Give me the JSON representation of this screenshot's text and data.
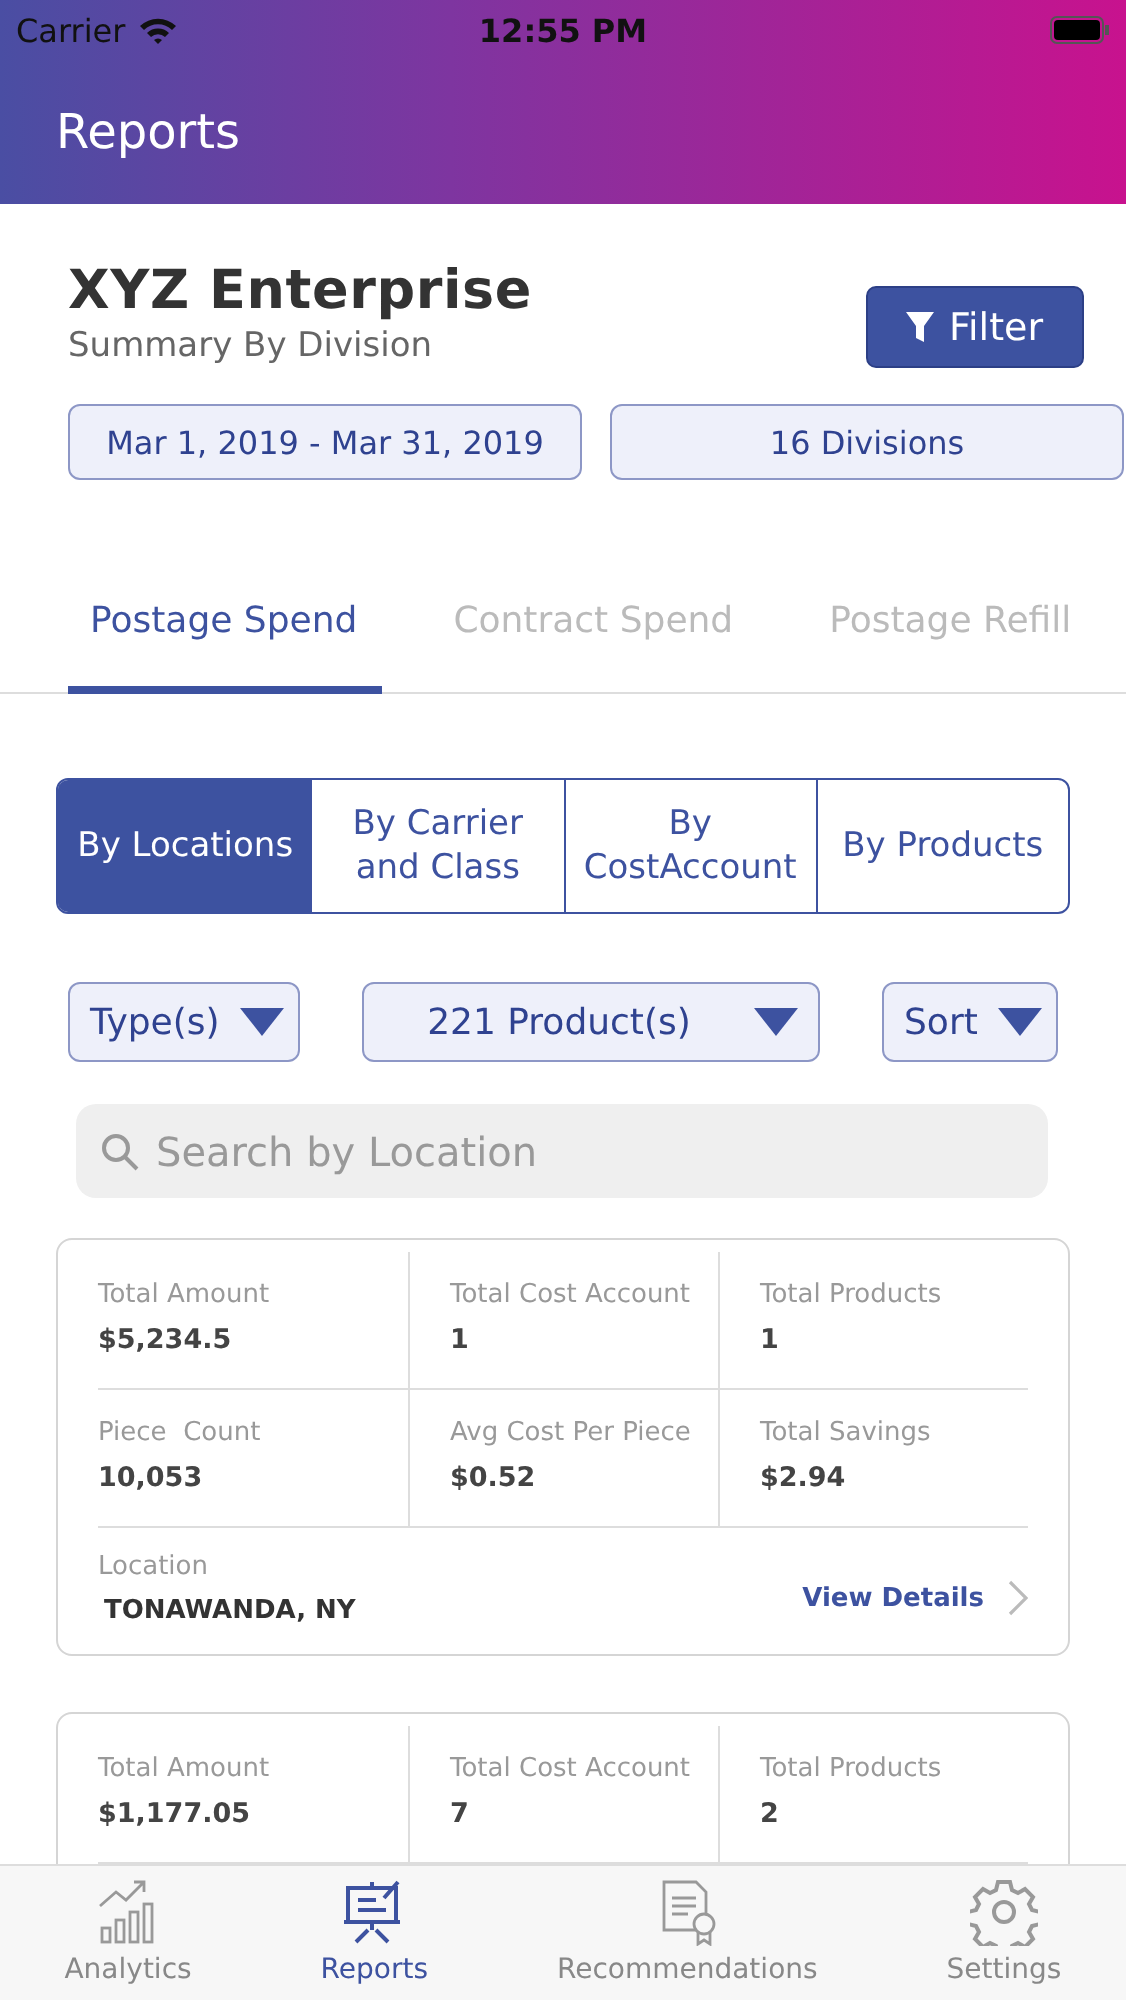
{
  "status_bar": {
    "carrier": "Carrier",
    "time": "12:55 PM"
  },
  "header": {
    "title": "Reports"
  },
  "summary": {
    "company": "XYZ Enterprise",
    "subtitle": "Summary By Division",
    "filter_button": "Filter",
    "chips": [
      "Mar 1, 2019 - Mar 31, 2019",
      "16 Divisions"
    ]
  },
  "tabs": [
    {
      "label": "Postage Spend",
      "selected": true
    },
    {
      "label": "Contract Spend",
      "selected": false
    },
    {
      "label": "Postage Refill",
      "selected": false
    }
  ],
  "segments": [
    {
      "label": "By Locations",
      "selected": true
    },
    {
      "label": "By Carrier and Class",
      "selected": false
    },
    {
      "label": "By CostAccount",
      "selected": false
    },
    {
      "label": "By Products",
      "selected": false
    }
  ],
  "dropdowns": [
    "Type(s)",
    "221 Product(s)",
    "Sort"
  ],
  "search": {
    "placeholder": "Search by Location"
  },
  "cards": [
    {
      "metrics": [
        {
          "label": "Total Amount",
          "value": "$5,234.5"
        },
        {
          "label": "Total Cost Account",
          "value": "1"
        },
        {
          "label": "Total Products",
          "value": "1"
        },
        {
          "label": "Piece  Count",
          "value": "10,053"
        },
        {
          "label": "Avg Cost Per Piece",
          "value": "$0.52"
        },
        {
          "label": "Total Savings",
          "value": "$2.94"
        }
      ],
      "location_label": "Location",
      "location": "TONAWANDA, NY",
      "link": "View Details"
    },
    {
      "metrics": [
        {
          "label": "Total Amount",
          "value": "$1,177.05"
        },
        {
          "label": "Total Cost Account",
          "value": "7"
        },
        {
          "label": "Total Products",
          "value": "2"
        }
      ]
    }
  ],
  "tab_bar": [
    {
      "label": "Analytics",
      "kind": "chart",
      "selected": false
    },
    {
      "label": "Reports",
      "kind": "easel",
      "selected": true
    },
    {
      "label": "Recommendations",
      "kind": "certificate",
      "selected": false
    },
    {
      "label": "Settings",
      "kind": "gear",
      "selected": false
    }
  ]
}
